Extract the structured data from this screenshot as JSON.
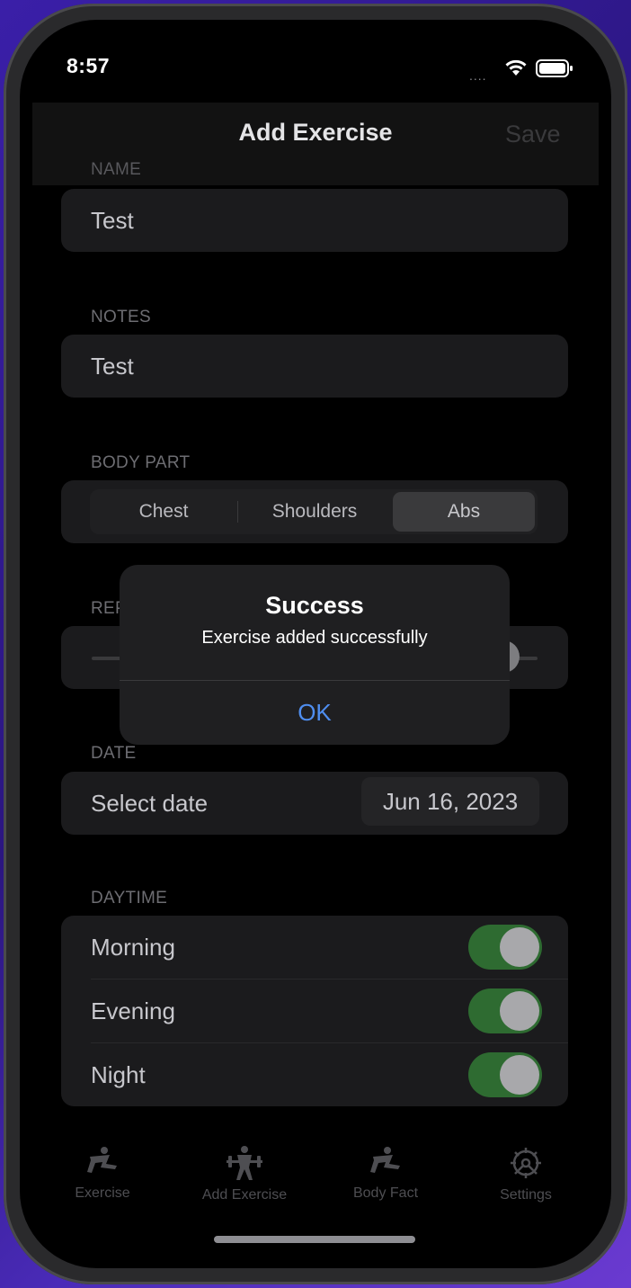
{
  "status_bar": {
    "time": "8:57",
    "signal": "...."
  },
  "nav": {
    "title": "Add Exercise",
    "save_label": "Save"
  },
  "form": {
    "name": {
      "header": "NAME",
      "value": "Test"
    },
    "notes": {
      "header": "NOTES",
      "value": "Test"
    },
    "body_part": {
      "header": "BODY PART",
      "segments": [
        "Chest",
        "Shoulders",
        "Abs"
      ],
      "selected": "Abs"
    },
    "reps": {
      "header_visible": "REP"
    },
    "date": {
      "header": "DATE",
      "label": "Select date",
      "value": "Jun 16, 2023"
    },
    "daytime": {
      "header": "DAYTIME",
      "rows": [
        {
          "label": "Morning",
          "on": true
        },
        {
          "label": "Evening",
          "on": true
        },
        {
          "label": "Night",
          "on": true
        }
      ]
    }
  },
  "alert": {
    "title": "Success",
    "message": "Exercise added successfully",
    "ok_label": "OK"
  },
  "tab_bar": {
    "items": [
      {
        "label": "Exercise",
        "icon": "exercise-icon"
      },
      {
        "label": "Add Exercise",
        "icon": "weightlifter-icon"
      },
      {
        "label": "Body Fact",
        "icon": "exercise-icon"
      },
      {
        "label": "Settings",
        "icon": "gear-icon"
      }
    ]
  },
  "colors": {
    "accent": "#4f8ef0",
    "toggle_on": "#2e6b31",
    "background": "#000000"
  }
}
